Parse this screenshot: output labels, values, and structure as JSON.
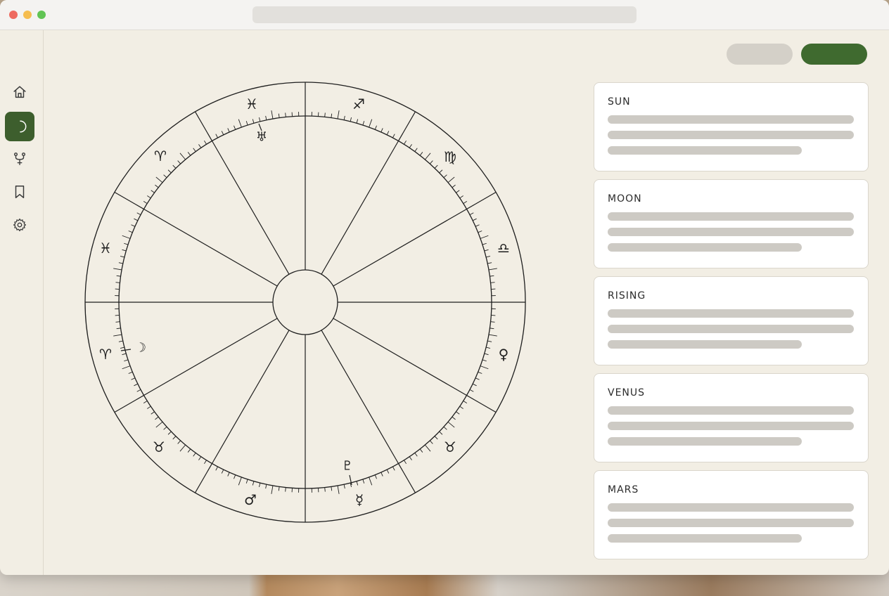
{
  "chart": {
    "signs_upper": [
      "♓",
      "♐",
      "♍",
      "♎",
      "♀",
      "♉",
      "☿",
      "♂",
      "♉",
      "♈",
      "♓",
      "♈"
    ],
    "planets": {
      "uranus": "♅",
      "moon": "☽",
      "pluto": "♇"
    }
  },
  "cards": [
    {
      "title": "SUN"
    },
    {
      "title": "MOON"
    },
    {
      "title": "RISING"
    },
    {
      "title": "VENUS"
    },
    {
      "title": "MARS"
    }
  ],
  "theme": {
    "accent": "#3d5e2d",
    "primary_button": "#3f6a2f",
    "background": "#f2eee4"
  }
}
